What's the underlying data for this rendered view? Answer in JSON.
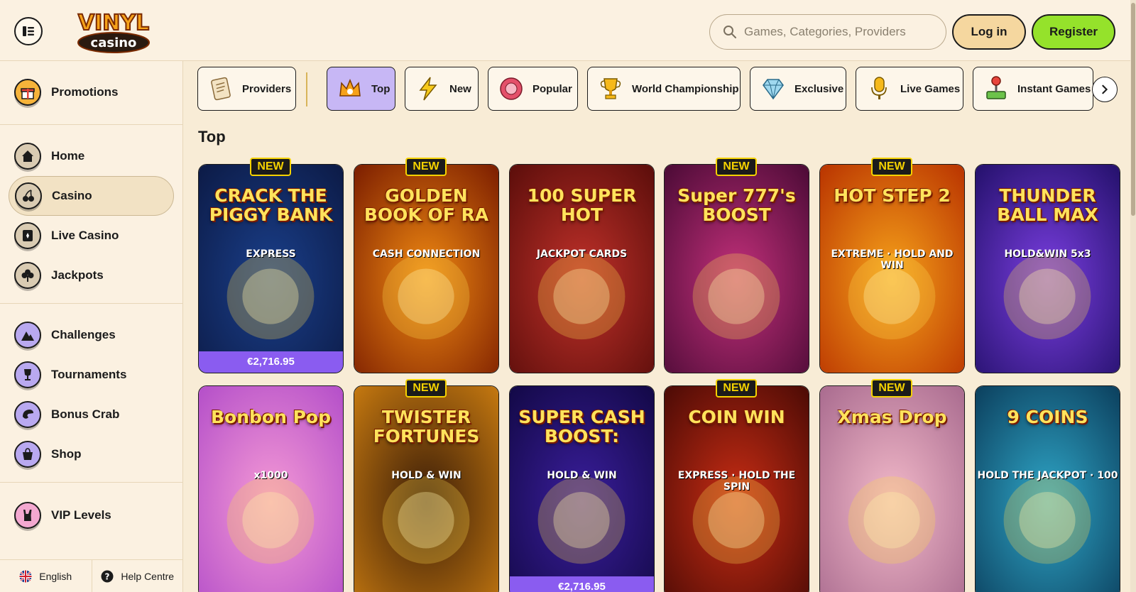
{
  "header": {
    "logo_top": "VINYL",
    "logo_bottom": "casino",
    "search_placeholder": "Games, Categories, Providers",
    "login_label": "Log in",
    "register_label": "Register"
  },
  "sidebar": {
    "promotions": "Promotions",
    "main": [
      {
        "label": "Home",
        "icon": "home-icon"
      },
      {
        "label": "Casino",
        "icon": "cherries-icon"
      },
      {
        "label": "Live Casino",
        "icon": "live-card-icon"
      },
      {
        "label": "Jackpots",
        "icon": "clover-icon"
      }
    ],
    "extras": [
      {
        "label": "Challenges",
        "icon": "mountain-icon"
      },
      {
        "label": "Tournaments",
        "icon": "trophy-icon"
      },
      {
        "label": "Bonus Crab",
        "icon": "crab-icon"
      },
      {
        "label": "Shop",
        "icon": "bag-icon"
      }
    ],
    "vip": "VIP Levels",
    "language": "English",
    "help": "Help Centre"
  },
  "categories": [
    {
      "label": "Providers",
      "icon": "scroll-icon"
    },
    {
      "label": "Top",
      "icon": "crown-icon",
      "active": true
    },
    {
      "label": "New",
      "icon": "lightning-icon"
    },
    {
      "label": "Popular",
      "icon": "chip-icon"
    },
    {
      "label": "World Championship",
      "icon": "trophy-icon"
    },
    {
      "label": "Exclusive",
      "icon": "diamond-icon"
    },
    {
      "label": "Live Games",
      "icon": "microphone-icon"
    },
    {
      "label": "Instant Games",
      "icon": "joystick-icon"
    }
  ],
  "section_title": "Top",
  "badge_new": "NEW",
  "games_row1": [
    {
      "title": "CRACK THE PIGGY BANK",
      "sub": "EXPRESS",
      "new": true,
      "jackpot": "€2,716.95",
      "bg1": "#1a3f8a",
      "bg2": "#0c1a45"
    },
    {
      "title": "GOLDEN BOOK OF RA",
      "sub": "CASH CONNECTION",
      "new": true,
      "jackpot": "",
      "bg1": "#f08a12",
      "bg2": "#7a1c00"
    },
    {
      "title": "100 SUPER HOT",
      "sub": "JACKPOT CARDS",
      "new": false,
      "jackpot": "",
      "bg1": "#c0312a",
      "bg2": "#5a0d0a"
    },
    {
      "title": "Super 777's BOOST",
      "sub": "",
      "new": true,
      "jackpot": "",
      "bg1": "#c2307a",
      "bg2": "#4a0a35"
    },
    {
      "title": "HOT STEP 2",
      "sub": "EXTREME · HOLD AND WIN",
      "new": true,
      "jackpot": "",
      "bg1": "#f6a21a",
      "bg2": "#b83200"
    },
    {
      "title": "THUNDER BALL MAX",
      "sub": "HOLD&WIN 5x3",
      "new": false,
      "jackpot": "",
      "bg1": "#7a3ee0",
      "bg2": "#23106a"
    }
  ],
  "games_row2": [
    {
      "title": "Bonbon Pop",
      "sub": "x1000",
      "new": false,
      "jackpot": "",
      "bg1": "#f59ad5",
      "bg2": "#b34ec9"
    },
    {
      "title": "TWISTER FORTUNES",
      "sub": "HOLD & WIN",
      "new": true,
      "jackpot": "",
      "bg1": "#3b1d08",
      "bg2": "#c77a10"
    },
    {
      "title": "SUPER CASH BOOST:",
      "sub": "HOLD & WIN",
      "new": false,
      "jackpot": "€2,716.95",
      "bg1": "#3a1e9c",
      "bg2": "#120845"
    },
    {
      "title": "COIN WIN",
      "sub": "EXPRESS · HOLD THE SPIN",
      "new": true,
      "jackpot": "",
      "bg1": "#c92d14",
      "bg2": "#4a0a05"
    },
    {
      "title": "Xmas Drop",
      "sub": "",
      "new": true,
      "jackpot": "",
      "bg1": "#f2b9c9",
      "bg2": "#a86a8e"
    },
    {
      "title": "9 COINS",
      "sub": "HOLD THE JACKPOT · 100",
      "new": false,
      "jackpot": "",
      "bg1": "#2fa6c7",
      "bg2": "#0b3e5c"
    }
  ]
}
